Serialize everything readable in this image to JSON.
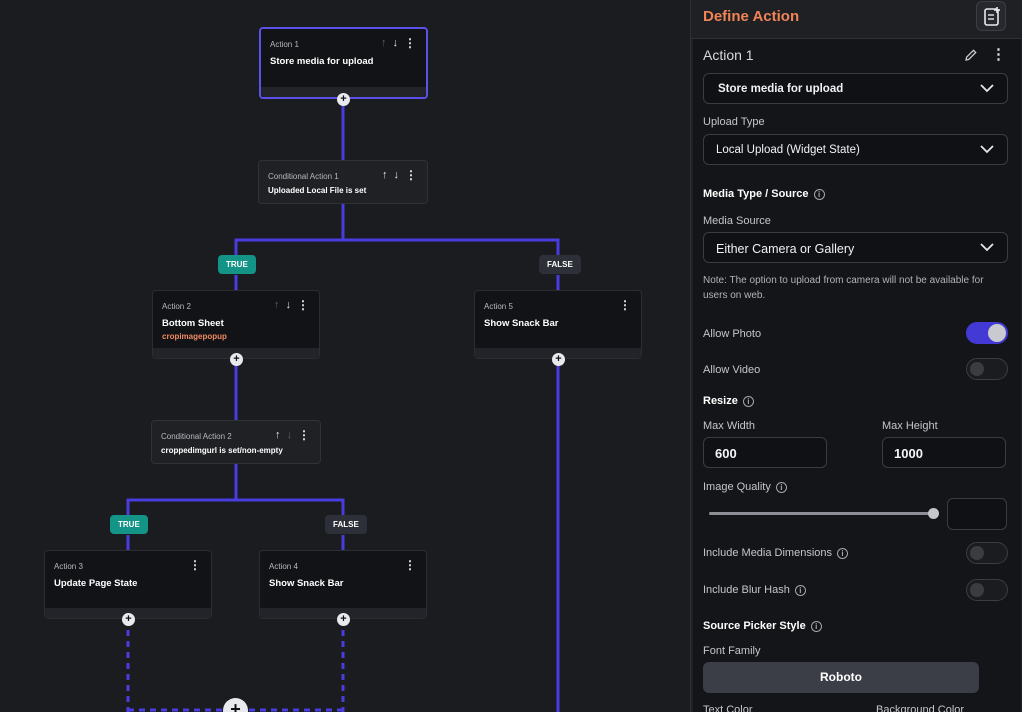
{
  "canvas": {
    "nodes": [
      {
        "kicker": "Action 1",
        "title": "Store media for upload",
        "subtitle": ""
      },
      {
        "kicker": "Conditional Action 1",
        "title": "Uploaded Local File is set"
      },
      {
        "kicker": "Action 2",
        "title": "Bottom Sheet",
        "subtitle": "cropimagepopup"
      },
      {
        "kicker": "Action 5",
        "title": "Show Snack Bar"
      },
      {
        "kicker": "Conditional Action 2",
        "title": "croppedimgurl is set/non-empty"
      },
      {
        "kicker": "Action 3",
        "title": "Update Page State"
      },
      {
        "kicker": "Action 4",
        "title": "Show Snack Bar"
      }
    ],
    "branch_labels": {
      "true": "TRUE",
      "false": "FALSE"
    },
    "add_symbol": "+"
  },
  "panel": {
    "title": "Define Action",
    "action_label": "Action 1",
    "action_type": "Store media for upload",
    "upload_type": {
      "label": "Upload Type",
      "value": "Local Upload (Widget State)"
    },
    "media_section": "Media Type / Source",
    "media_source": {
      "label": "Media Source",
      "value": "Either Camera or Gallery"
    },
    "note": "Note: The option to upload from camera will not be available for users on web.",
    "allow_photo": {
      "label": "Allow Photo",
      "on": true
    },
    "allow_video": {
      "label": "Allow Video",
      "on": false
    },
    "resize": {
      "label": "Resize",
      "max_width_label": "Max Width",
      "max_width": "600",
      "max_height_label": "Max Height",
      "max_height": "1000"
    },
    "image_quality": {
      "label": "Image Quality",
      "value": 1.0
    },
    "include_media_dimensions": {
      "label": "Include Media Dimensions",
      "on": false
    },
    "include_blur_hash": {
      "label": "Include Blur Hash",
      "on": false
    },
    "source_picker": {
      "label": "Source Picker Style",
      "font_family_label": "Font Family",
      "font_family": "Roboto",
      "text_color_label": "Text Color",
      "background_color_label": "Background Color"
    },
    "colors": {
      "accent": "#f08457",
      "toggle_on": "#4339d4",
      "link_line": "#4a3de0",
      "true_badge": "#139487"
    }
  }
}
